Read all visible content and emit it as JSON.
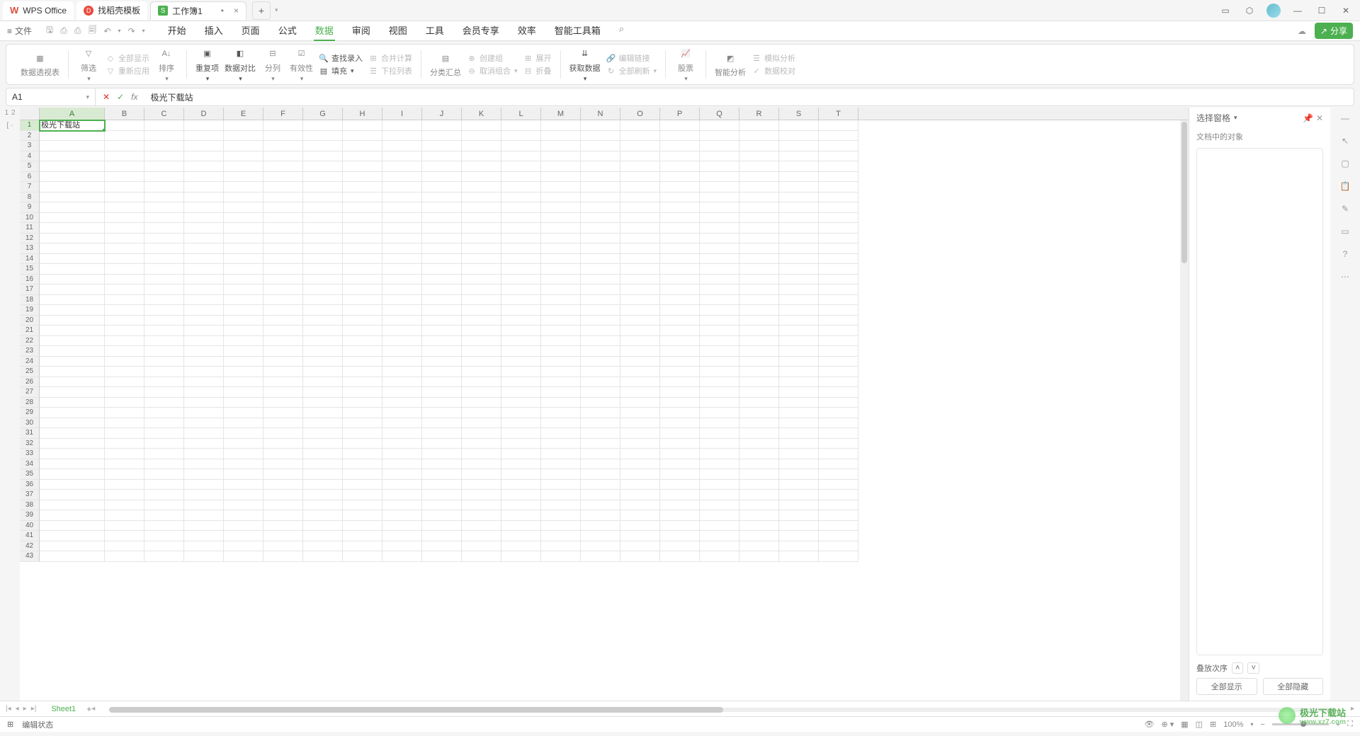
{
  "titlebar": {
    "tabs": [
      {
        "name": "wps-home",
        "label": "WPS Office"
      },
      {
        "name": "docer",
        "label": "找稻壳模板"
      },
      {
        "name": "workbook",
        "label": "工作簿1",
        "modified": "•",
        "badge": "S"
      }
    ]
  },
  "menu": {
    "file_label": "文件",
    "tabs": [
      "开始",
      "插入",
      "页面",
      "公式",
      "数据",
      "审阅",
      "视图",
      "工具",
      "会员专享",
      "效率",
      "智能工具箱"
    ],
    "active": "数据",
    "share_label": "分享"
  },
  "ribbon": {
    "g1": {
      "pivot": "数据透视表"
    },
    "g2": {
      "filter": "筛选",
      "show_all": "全部显示",
      "reapply": "重新应用",
      "sort": "排序"
    },
    "g3": {
      "dup": "重复项",
      "compare": "数据对比",
      "split": "分列",
      "validate": "有效性",
      "lookup": "查找录入",
      "merge": "合并计算",
      "fill": "填充",
      "dropdown": "下拉列表"
    },
    "g4": {
      "subtotal": "分类汇总",
      "group": "创建组",
      "ungroup": "取消组合",
      "expand": "展开",
      "collapse": "折叠"
    },
    "g5": {
      "getdata": "获取数据",
      "editlink": "编辑链接",
      "refresh": "全部刷新"
    },
    "g6": {
      "stock": "股票"
    },
    "g7": {
      "ai": "智能分析",
      "sim": "模拟分析",
      "audit": "数据校对"
    }
  },
  "formulabar": {
    "namebox": "A1",
    "content": "极光下载站"
  },
  "grid": {
    "cols": [
      "A",
      "B",
      "C",
      "D",
      "E",
      "F",
      "G",
      "H",
      "I",
      "J",
      "K",
      "L",
      "M",
      "N",
      "O",
      "P",
      "Q",
      "R",
      "S",
      "T"
    ],
    "rows": 43,
    "active_cell": {
      "r": 1,
      "c": "A",
      "value": "极光下载站"
    },
    "outline": {
      "top": [
        "1",
        "2"
      ]
    }
  },
  "rightpanel": {
    "title": "选择窗格",
    "subtitle": "文档中的对象",
    "stack_label": "叠放次序",
    "show_all": "全部显示",
    "hide_all": "全部隐藏"
  },
  "sheets": {
    "active": "Sheet1"
  },
  "statusbar": {
    "mode": "编辑状态",
    "zoom": "100%"
  },
  "watermark": {
    "l1": "极光下载站",
    "l2": "www.xz7.com"
  }
}
